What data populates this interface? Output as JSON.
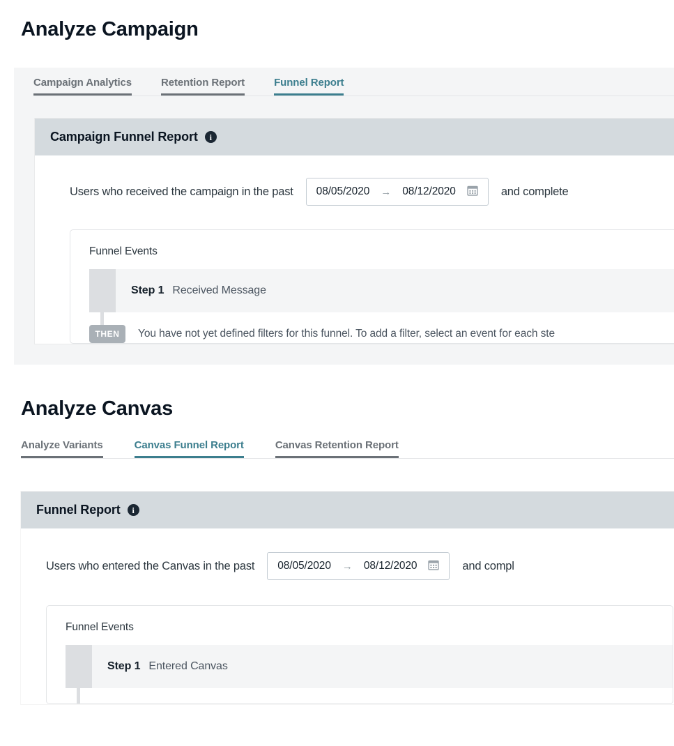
{
  "sections": [
    {
      "heading": "Analyze Campaign",
      "tabs": [
        {
          "label": "Campaign Analytics",
          "active": false
        },
        {
          "label": "Retention Report",
          "active": false
        },
        {
          "label": "Funnel Report",
          "active": true
        }
      ],
      "card": {
        "title": "Campaign Funnel Report",
        "info_icon": "info-icon",
        "info_glyph": "i",
        "date_row": {
          "label": "Users who received the campaign in the past",
          "start_date": "08/05/2020",
          "arrow_glyph": "→",
          "end_date": "08/12/2020",
          "calendar_icon": "calendar-icon",
          "trailing_text": "and complete"
        },
        "funnel": {
          "panel_title": "Funnel Events",
          "steps": [
            {
              "number": "Step 1",
              "event": "Received Message"
            }
          ],
          "then_badge": "THEN",
          "then_text": "You have not yet defined filters for this funnel. To add a filter, select an event for each ste"
        }
      }
    },
    {
      "heading": "Analyze Canvas",
      "tabs": [
        {
          "label": "Analyze Variants",
          "active": false
        },
        {
          "label": "Canvas Funnel Report",
          "active": true
        },
        {
          "label": "Canvas Retention Report",
          "active": false
        }
      ],
      "card": {
        "title": "Funnel Report",
        "info_icon": "info-icon",
        "info_glyph": "i",
        "date_row": {
          "label": "Users who entered the Canvas in the past",
          "start_date": "08/05/2020",
          "arrow_glyph": "→",
          "end_date": "08/12/2020",
          "calendar_icon": "calendar-icon",
          "trailing_text": "and compl"
        },
        "funnel": {
          "panel_title": "Funnel Events",
          "steps": [
            {
              "number": "Step 1",
              "event": "Entered Canvas"
            }
          ]
        }
      }
    }
  ],
  "colors": {
    "accent_teal": "#3c7e8e",
    "tab_inactive": "#6b7177",
    "card_header_bg": "#d4dade",
    "step_row_bg": "#f4f5f6",
    "drag_handle": "#dcdee1",
    "then_badge": "#a9b0b6",
    "heading_text": "#0b1521"
  }
}
